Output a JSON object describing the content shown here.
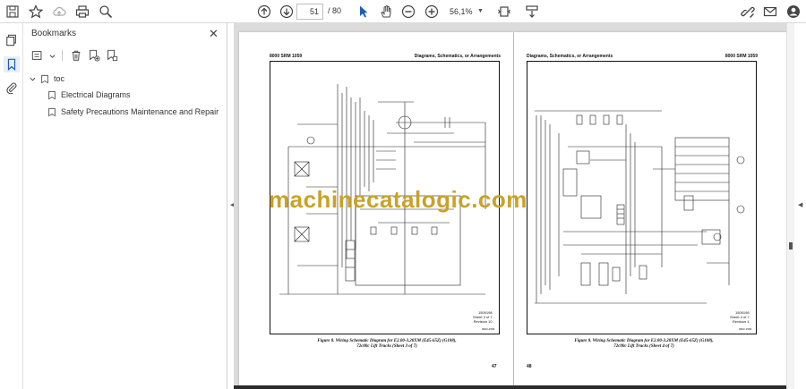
{
  "toolbar": {
    "page_current": "51",
    "page_total": "/ 80",
    "zoom": "56,1%"
  },
  "panel": {
    "title": "Bookmarks",
    "items": [
      {
        "label": "toc"
      },
      {
        "label": "Electrical Diagrams"
      },
      {
        "label": "Safety Precautions Maintenance and Repair"
      }
    ]
  },
  "document": {
    "left_page": {
      "header_left": "8000 SRM 1059",
      "header_right": "Diagrams, Schematics, or Arrangements",
      "sheet_info": [
        "1509198",
        "Sheet 3 of 7",
        "Revision 10"
      ],
      "code": "9962-1566",
      "caption": [
        "Figure 8.  Wiring Schematic Diagram for E2.00-3.20XM (E45-65Z) (G108),",
        "72c00c Lift Trucks (Sheet 3 of 7)"
      ],
      "page_number": "47"
    },
    "right_page": {
      "header_left": "Diagrams, Schematics, or Arrangements",
      "header_right": "8000 SRM 1059",
      "sheet_info": [
        "1509198",
        "Sheet 4 of 7",
        "Revision 4"
      ],
      "code": "9962-1566",
      "caption": [
        "Figure 8.  Wiring Schematic Diagram for E2.00-3.20XM (E45-65Z) (G108),",
        "72c00c Lift Trucks (Sheet 4 of 7)"
      ],
      "page_number": "48"
    },
    "watermark": "machinecatalogic.com"
  },
  "colors": {
    "watermark": "#c9a227",
    "accent": "#1a5fb4",
    "viewer_bg": "#dcdcdc"
  }
}
